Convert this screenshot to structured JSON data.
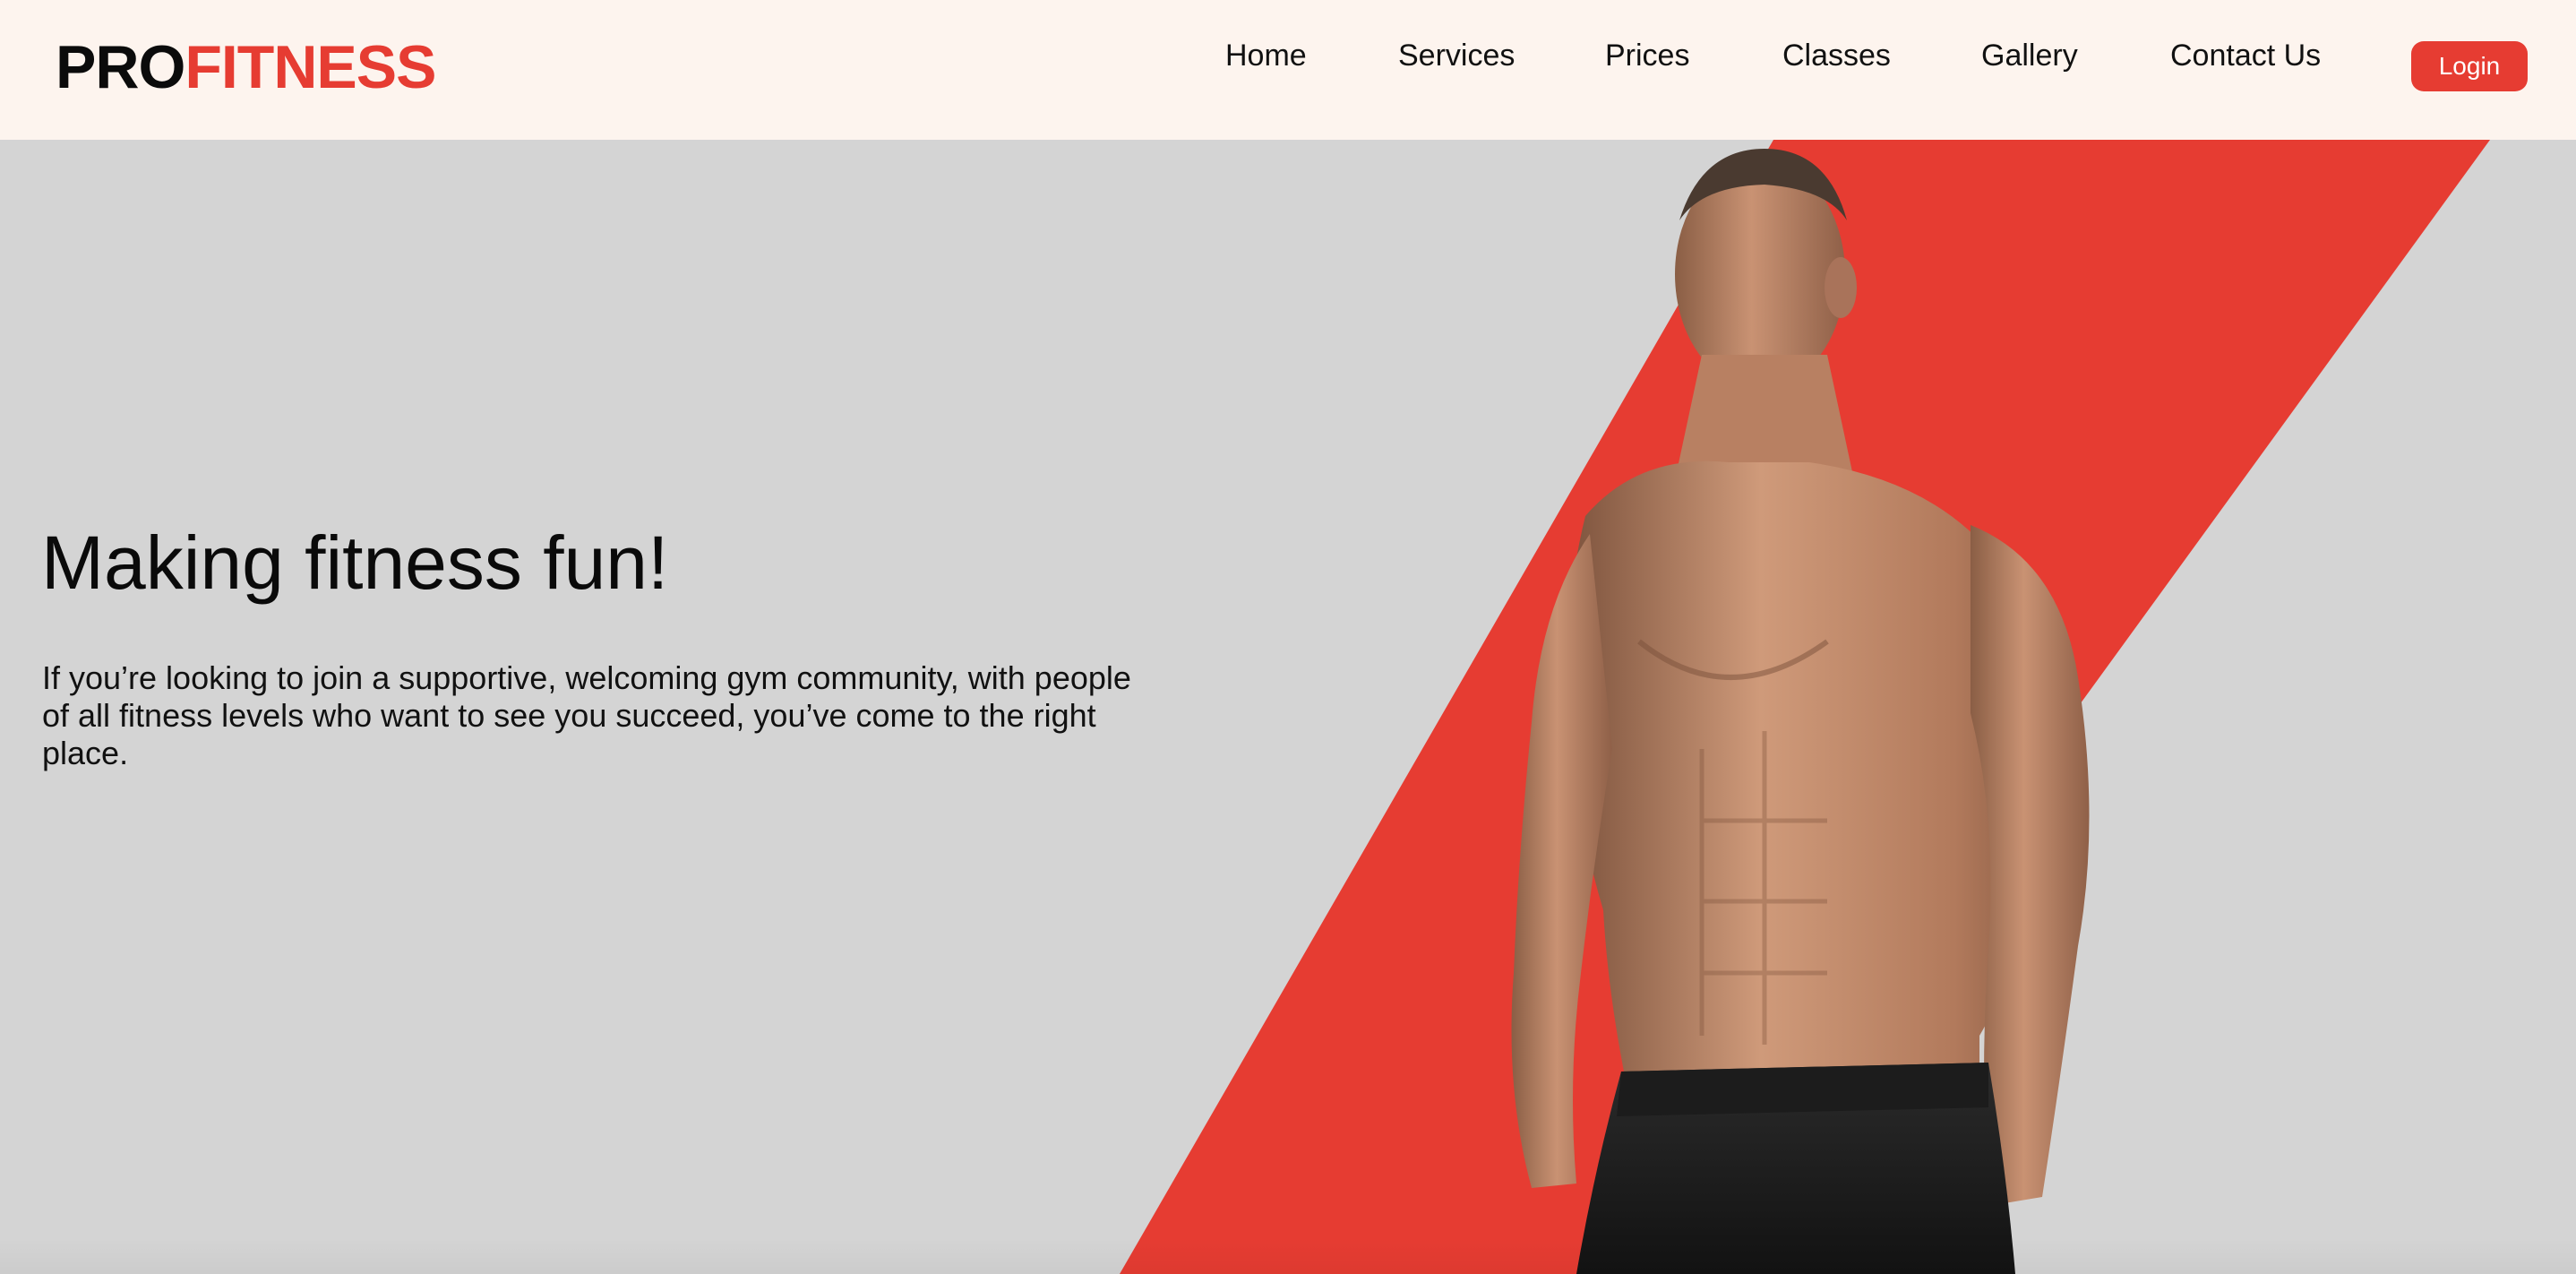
{
  "header": {
    "logo_part1": "PRO",
    "logo_part2": "FITNESS",
    "nav": {
      "home": "Home",
      "services": "Services",
      "prices": "Prices",
      "classes": "Classes",
      "gallery": "Gallery",
      "contact": "Contact Us"
    },
    "login_label": "Login"
  },
  "hero": {
    "title": "Making fitness fun!",
    "body": "If you’re looking to join a supportive, welcoming gym community, with people of all fitness levels who want to see you succeed, you’ve come to the right place."
  },
  "colors": {
    "brand_red": "#e63c32",
    "header_bg": "#fdf4ee",
    "hero_bg": "#d4d4d4",
    "text": "#0a0a0a"
  },
  "icons": {
    "hero_image": "athlete-photo"
  }
}
